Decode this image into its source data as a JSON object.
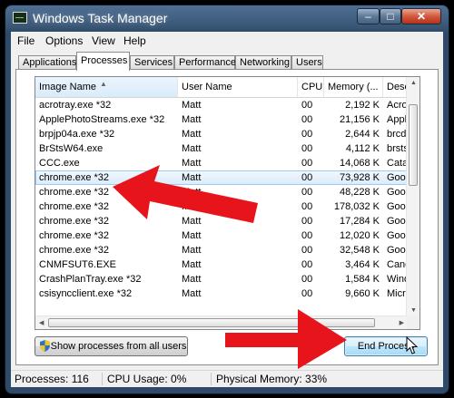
{
  "window": {
    "title": "Windows Task Manager",
    "min_label": "–",
    "max_label": "□",
    "close_label": "✕"
  },
  "menu": [
    "File",
    "Options",
    "View",
    "Help"
  ],
  "tabs": [
    "Applications",
    "Processes",
    "Services",
    "Performance",
    "Networking",
    "Users"
  ],
  "active_tab": "Processes",
  "columns": {
    "image": "Image Name",
    "user": "User Name",
    "cpu": "CPU",
    "memory": "Memory (...",
    "desc": "Descr"
  },
  "rows": [
    {
      "name": "acrotray.exe *32",
      "user": "Matt",
      "cpu": "00",
      "mem": "2,192 K",
      "desc": "AcroT"
    },
    {
      "name": "ApplePhotoStreams.exe *32",
      "user": "Matt",
      "cpu": "00",
      "mem": "21,156 K",
      "desc": "Apple"
    },
    {
      "name": "brpjp04a.exe *32",
      "user": "Matt",
      "cpu": "00",
      "mem": "2,644 K",
      "desc": "brcdc"
    },
    {
      "name": "BrStsW64.exe",
      "user": "Matt",
      "cpu": "00",
      "mem": "4,112 K",
      "desc": "brstsw"
    },
    {
      "name": "CCC.exe",
      "user": "Matt",
      "cpu": "00",
      "mem": "14,068 K",
      "desc": "Catal"
    },
    {
      "name": "chrome.exe *32",
      "user": "Matt",
      "cpu": "00",
      "mem": "73,928 K",
      "desc": "Googl"
    },
    {
      "name": "chrome.exe *32",
      "user": "Matt",
      "cpu": "00",
      "mem": "48,228 K",
      "desc": "Googl"
    },
    {
      "name": "chrome.exe *32",
      "user": "Matt",
      "cpu": "00",
      "mem": "178,032 K",
      "desc": "Googl"
    },
    {
      "name": "chrome.exe *32",
      "user": "Matt",
      "cpu": "00",
      "mem": "17,284 K",
      "desc": "Googl"
    },
    {
      "name": "chrome.exe *32",
      "user": "Matt",
      "cpu": "00",
      "mem": "12,020 K",
      "desc": "Googl"
    },
    {
      "name": "chrome.exe *32",
      "user": "Matt",
      "cpu": "00",
      "mem": "32,548 K",
      "desc": "Googl"
    },
    {
      "name": "CNMFSUT6.EXE",
      "user": "Matt",
      "cpu": "00",
      "mem": "3,464 K",
      "desc": "Canor"
    },
    {
      "name": "CrashPlanTray.exe *32",
      "user": "Matt",
      "cpu": "00",
      "mem": "1,584 K",
      "desc": "Windo"
    },
    {
      "name": "csisyncclient.exe *32",
      "user": "Matt",
      "cpu": "00",
      "mem": "9,660 K",
      "desc": "Micros"
    }
  ],
  "selected_row": 5,
  "buttons": {
    "show_all": "Show processes from all users",
    "end_process": "End Process"
  },
  "status": {
    "processes": "Processes: 116",
    "cpu": "CPU Usage: 0%",
    "memory": "Physical Memory: 33%"
  },
  "annotation_color": "#e8141b"
}
